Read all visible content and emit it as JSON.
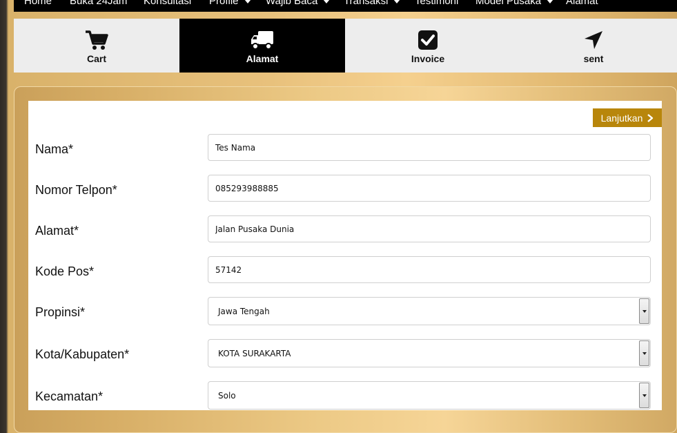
{
  "nav": {
    "items": [
      {
        "label": "Home",
        "dropdown": false
      },
      {
        "label": "Buka 24Jam",
        "dropdown": false
      },
      {
        "label": "Konsultasi",
        "dropdown": false
      },
      {
        "label": "Profile",
        "dropdown": true
      },
      {
        "label": "Wajib Baca",
        "dropdown": true
      },
      {
        "label": "Transaksi",
        "dropdown": true
      },
      {
        "label": "Testimoni",
        "dropdown": false
      },
      {
        "label": "Model Pusaka",
        "dropdown": true
      },
      {
        "label": "Alamat",
        "dropdown": false
      }
    ]
  },
  "steps": [
    {
      "label": "Cart",
      "icon": "cart-icon",
      "active": false
    },
    {
      "label": "Alamat",
      "icon": "truck-icon",
      "active": true
    },
    {
      "label": "Invoice",
      "icon": "check-square-icon",
      "active": false
    },
    {
      "label": "sent",
      "icon": "location-arrow-icon",
      "active": false
    }
  ],
  "form": {
    "next_label": "Lanjutkan",
    "fields": [
      {
        "label": "Nama*",
        "value": "Tes Nama",
        "type": "text"
      },
      {
        "label": "Nomor Telpon*",
        "value": "085293988885",
        "type": "text"
      },
      {
        "label": "Alamat*",
        "value": "Jalan Pusaka Dunia",
        "type": "text"
      },
      {
        "label": "Kode Pos*",
        "value": "57142",
        "type": "text"
      },
      {
        "label": "Propinsi*",
        "value": "Jawa Tengah",
        "type": "select"
      },
      {
        "label": "Kota/Kabupaten*",
        "value": "KOTA SURAKARTA",
        "type": "select"
      },
      {
        "label": "Kecamatan*",
        "value": "Solo",
        "type": "select"
      }
    ]
  },
  "colors": {
    "accent": "#b8860b",
    "nav_bg": "#000000",
    "step_active_bg": "#000000",
    "step_bg": "#ededed"
  }
}
